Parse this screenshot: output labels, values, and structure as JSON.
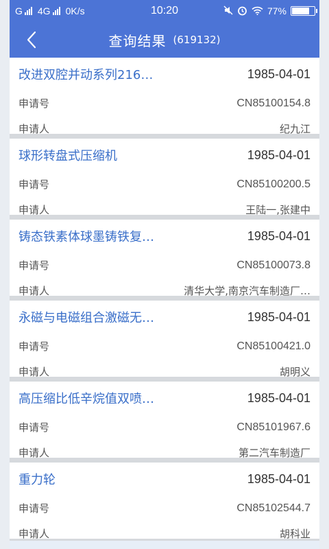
{
  "status_bar": {
    "network_left": "G",
    "network_4g": "4G",
    "speed": "0K/s",
    "time": "10:20",
    "battery": "77%",
    "battery_level": 0.77
  },
  "header": {
    "title": "查询结果",
    "count": "(619132)"
  },
  "labels": {
    "app_no": "申请号",
    "applicant": "申请人"
  },
  "results": [
    {
      "title": "改进双腔并动系列216…",
      "date": "1985-04-01",
      "app_no": "CN85100154.8",
      "applicant": "纪九江"
    },
    {
      "title": "球形转盘式压缩机",
      "date": "1985-04-01",
      "app_no": "CN85100200.5",
      "applicant": "王陆一,张建中"
    },
    {
      "title": "铸态铁素体球墨铸铁复…",
      "date": "1985-04-01",
      "app_no": "CN85100073.8",
      "applicant": "清华大学,南京汽车制造厂…"
    },
    {
      "title": "永磁与电磁组合激磁无…",
      "date": "1985-04-01",
      "app_no": "CN85100421.0",
      "applicant": "胡明义"
    },
    {
      "title": "高压缩比低辛烷值双喷…",
      "date": "1985-04-01",
      "app_no": "CN85101967.6",
      "applicant": "第二汽车制造厂"
    },
    {
      "title": "重力轮",
      "date": "1985-04-01",
      "app_no": "CN85102544.7",
      "applicant": "胡科业"
    }
  ],
  "colors": {
    "header_bg": "#4c74d6",
    "title_link": "#3a6fc9",
    "divider": "#d6d9dd"
  }
}
